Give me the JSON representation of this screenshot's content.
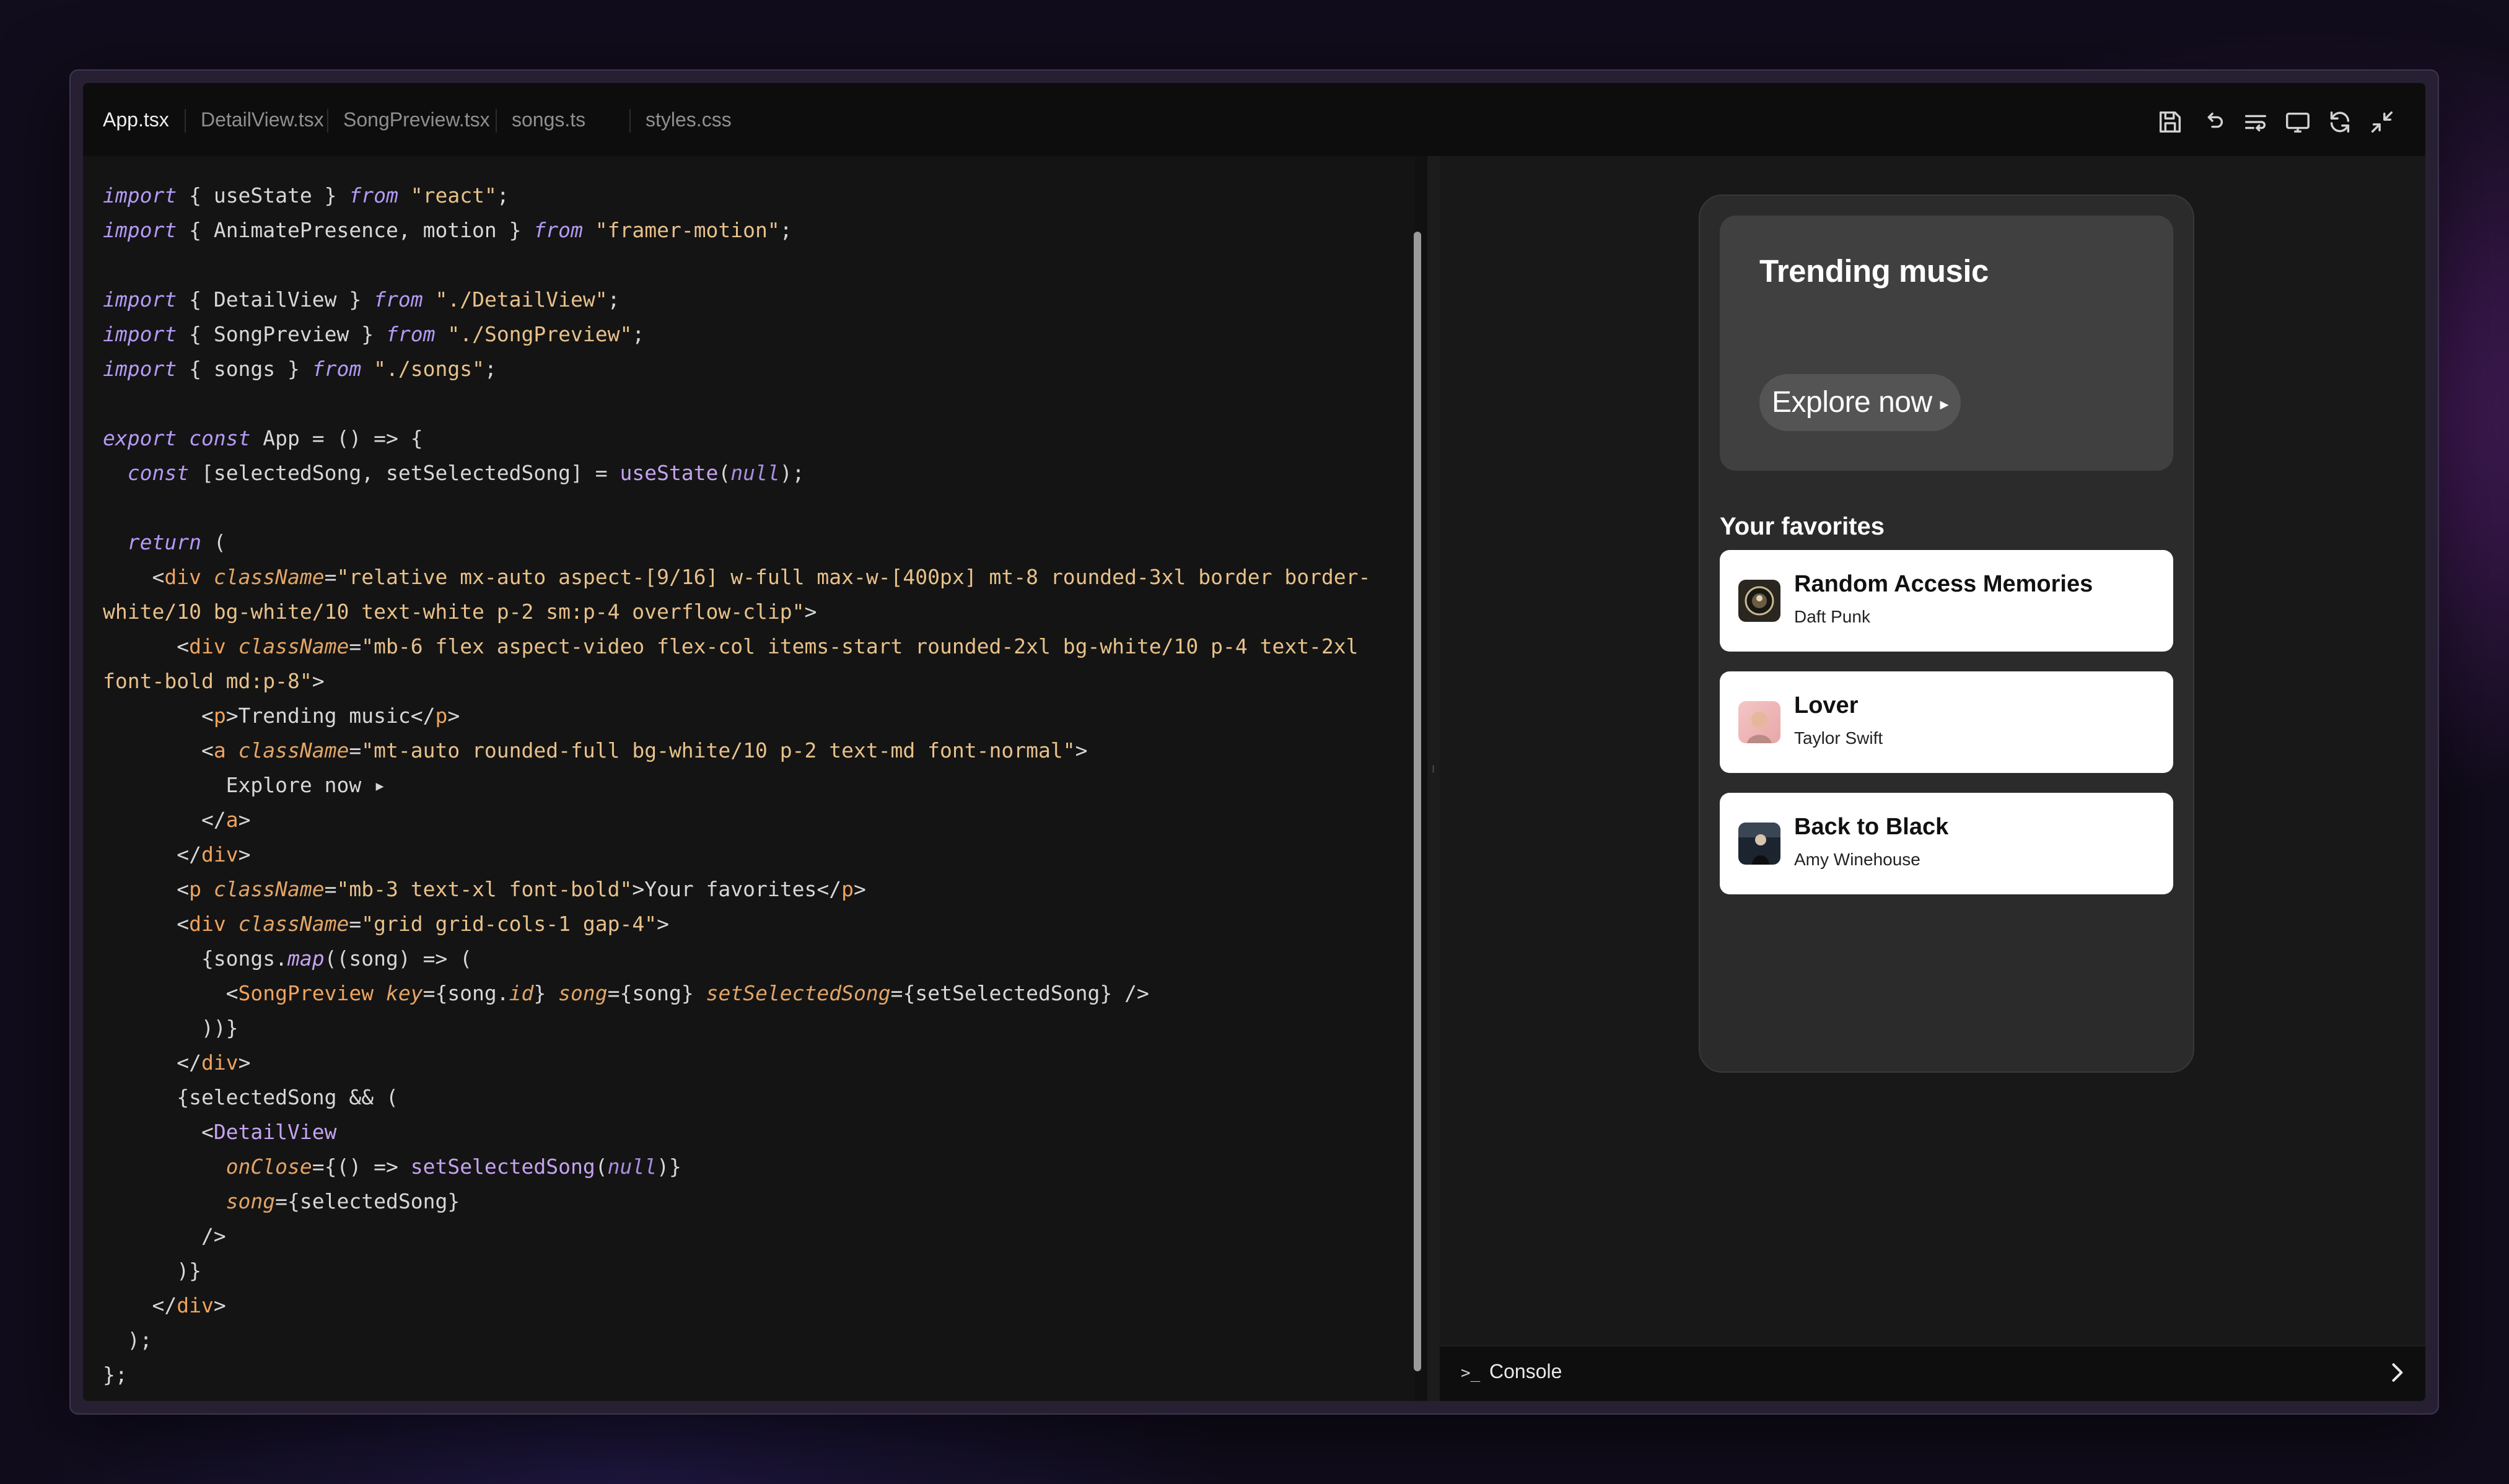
{
  "tabs": [
    {
      "label": "App.tsx",
      "active": true
    },
    {
      "label": "DetailView.tsx",
      "active": false
    },
    {
      "label": "SongPreview.tsx",
      "active": false
    },
    {
      "label": "songs.ts",
      "active": false
    },
    {
      "label": "styles.css",
      "active": false
    }
  ],
  "toolbar": {
    "icons": [
      "save-icon",
      "undo-icon",
      "format-icon",
      "monitor-icon",
      "refresh-icon",
      "collapse-icon"
    ]
  },
  "code": {
    "language": "tsx",
    "lines": [
      "import { useState } from \"react\";",
      "import { AnimatePresence, motion } from \"framer-motion\";",
      "",
      "import { DetailView } from \"./DetailView\";",
      "import { SongPreview } from \"./SongPreview\";",
      "import { songs } from \"./songs\";",
      "",
      "export const App = () => {",
      "  const [selectedSong, setSelectedSong] = useState(null);",
      "",
      "  return (",
      "    <div className=\"relative mx-auto aspect-[9/16] w-full max-w-[400px] mt-8 rounded-3xl border border-",
      "white/10 bg-white/10 text-white p-2 sm:p-4 overflow-clip\">",
      "      <div className=\"mb-6 flex aspect-video flex-col items-start rounded-2xl bg-white/10 p-4 text-2xl",
      "font-bold md:p-8\">",
      "        <p>Trending music</p>",
      "        <a className=\"mt-auto rounded-full bg-white/10 p-2 text-md font-normal\">",
      "          Explore now ▸",
      "        </a>",
      "      </div>",
      "      <p className=\"mb-3 text-xl font-bold\">Your favorites</p>",
      "      <div className=\"grid grid-cols-1 gap-4\">",
      "        {songs.map((song) => (",
      "          <SongPreview key={song.id} song={song} setSelectedSong={setSelectedSong} />",
      "        ))}",
      "      </div>",
      "      {selectedSong && (",
      "        <DetailView",
      "          onClose={() => setSelectedSong(null)}",
      "          song={selectedSong}",
      "        />",
      "      )}",
      "    </div>",
      "  );",
      "};"
    ]
  },
  "preview": {
    "trending_title": "Trending music",
    "explore_label": "Explore now",
    "explore_arrow": "▸",
    "favorites_title": "Your favorites",
    "songs": [
      {
        "title": "Random Access Memories",
        "artist": "Daft Punk"
      },
      {
        "title": "Lover",
        "artist": "Taylor Swift"
      },
      {
        "title": "Back to Black",
        "artist": "Amy Winehouse"
      }
    ]
  },
  "console": {
    "prompt_icon": "terminal-prompt-icon",
    "label": "Console"
  },
  "colors": {
    "background": "#110d1c",
    "window_frame": "#272033",
    "editor_bg": "#141414",
    "keyword": "#b49af5",
    "string": "#e8c18a",
    "tag": "#f0a35e",
    "card_bg": "#404040",
    "song_card": "#ffffff"
  }
}
